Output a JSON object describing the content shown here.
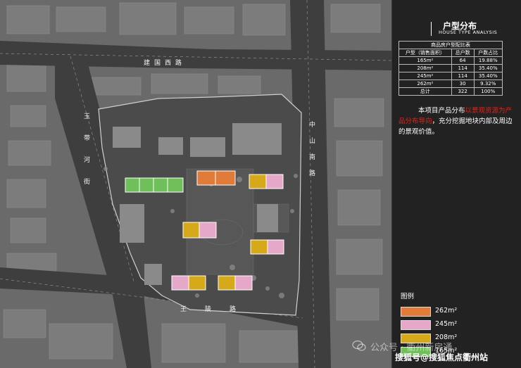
{
  "panel": {
    "title": "户型分布",
    "subtitle": "HOUSE TYPE ANALYSIS",
    "table": {
      "caption": "商品房户型配比表",
      "headers": [
        "户型（销售面积）",
        "总户数",
        "户数占比"
      ],
      "rows": [
        [
          "165m²",
          "64",
          "19.88%"
        ],
        [
          "208m²",
          "114",
          "35.40%"
        ],
        [
          "245m²",
          "114",
          "35.40%"
        ],
        [
          "262m²",
          "30",
          "9.32%"
        ],
        [
          "总计",
          "322",
          "100%"
        ]
      ]
    },
    "description_plain_1": "本项目产品分布",
    "description_highlight": "以景观资源为产品分布导向",
    "description_plain_2": "，充分挖掘地块内部及周边的景观价值。"
  },
  "legend": {
    "title": "图例",
    "items": [
      {
        "label": "262m²",
        "color": "#e07b3a"
      },
      {
        "label": "245m²",
        "color": "#e6a8c8"
      },
      {
        "label": "208m²",
        "color": "#d6a91a"
      },
      {
        "label": "165m²",
        "color": "#6fbf5a"
      }
    ]
  },
  "roads": {
    "jianguo_west": "建国西路",
    "zhongshan_south": "中山南路",
    "yuxi_river": "玉带河街",
    "wangling": "王陵路"
  },
  "watermarks": {
    "wechat": "公众号 · 衢州新房通",
    "sohu": "搜狐号@搜狐焦点衢州站"
  },
  "colors": {
    "c262": "#e07b3a",
    "c245": "#e6a8c8",
    "c208": "#d6a91a",
    "c165": "#6fbf5a"
  }
}
